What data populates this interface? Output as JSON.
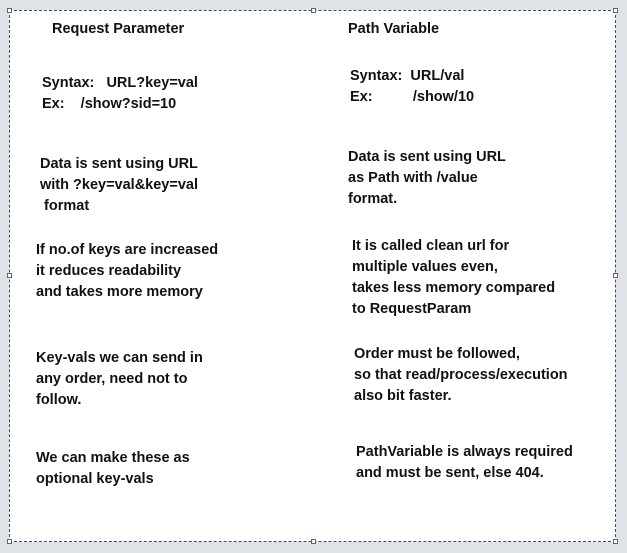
{
  "left": {
    "heading": "Request Parameter",
    "syntax": [
      "Syntax:   URL?key=val",
      "Ex:    /show?sid=10"
    ],
    "data_sent": [
      "Data is sent using URL",
      "with ?key=val&key=val",
      " format"
    ],
    "keys": [
      "If no.of keys are increased",
      "it reduces readability",
      "and takes more memory"
    ],
    "order": [
      "Key-vals we can send in",
      "any order, need not to",
      "follow."
    ],
    "optional": [
      "We can make these as",
      "optional key-vals"
    ]
  },
  "right": {
    "heading": "Path Variable",
    "syntax": [
      "Syntax:  URL/val",
      "Ex:          /show/10"
    ],
    "data_sent": [
      "Data is sent using URL",
      "as Path with /value",
      "format."
    ],
    "clean": [
      "It is called clean url for",
      "multiple values even,",
      "takes less memory compared",
      "to RequestParam"
    ],
    "order": [
      "Order must be followed,",
      "so that read/process/execution",
      "also bit faster."
    ],
    "required": [
      "PathVariable is always required",
      "and must be sent, else 404."
    ]
  }
}
